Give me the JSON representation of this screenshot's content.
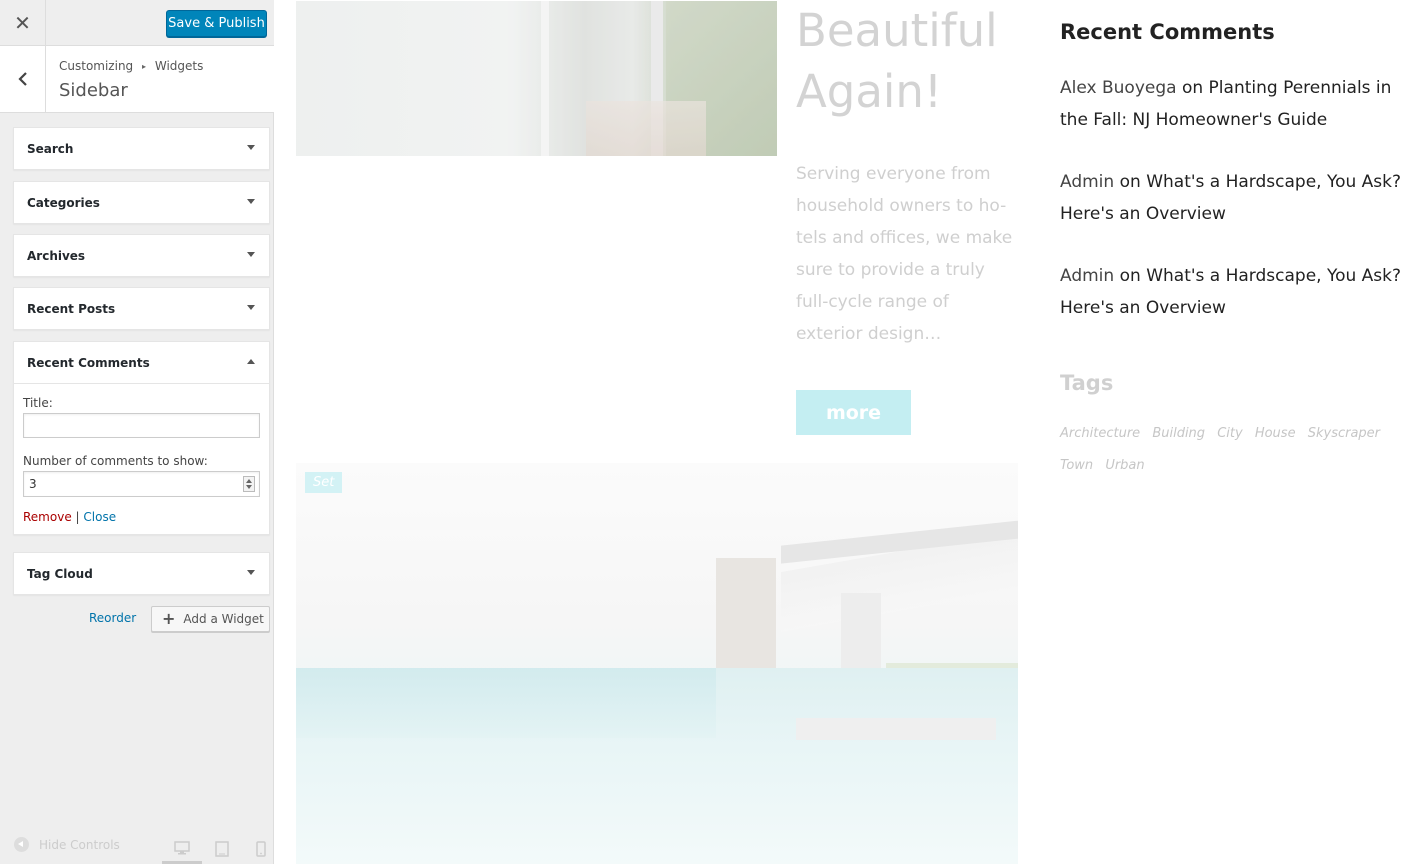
{
  "customizer": {
    "close_label": "✕",
    "publish_label": "Save & Publish",
    "breadcrumb": {
      "root": "Customizing",
      "separator": "▸",
      "current": "Widgets"
    },
    "section_title": "Sidebar",
    "widgets": [
      {
        "title": "Search",
        "expanded": false
      },
      {
        "title": "Categories",
        "expanded": false
      },
      {
        "title": "Archives",
        "expanded": false
      },
      {
        "title": "Recent Posts",
        "expanded": false
      },
      {
        "title": "Recent Comments",
        "expanded": true
      },
      {
        "title": "Tag Cloud",
        "expanded": false
      }
    ],
    "recent_comments_form": {
      "title_label": "Title:",
      "title_value": "",
      "number_label": "Number of comments to show:",
      "number_value": "3",
      "remove_label": "Remove",
      "divider": "|",
      "close_label": "Close"
    },
    "reorder_label": "Reorder",
    "add_widget_label": "Add a Widget",
    "hide_controls_label": "Hide Controls",
    "devices": [
      "desktop-icon",
      "tablet-icon",
      "mobile-icon"
    ]
  },
  "preview": {
    "post_title_lines": [
      "Beautiful",
      "Again!"
    ],
    "post_excerpt": "Serving everyone from household owners to ho-tels and offices, we make sure to provide a truly full-cycle range of exterior design…",
    "more_label": "more",
    "set_badge": "Set",
    "sidebar": {
      "recent_comments_heading": "Recent Comments",
      "comments": [
        {
          "author": "Alex Buoyega",
          "on": "on",
          "post": "Planting Perennials in the Fall: NJ Homeowner's Guide"
        },
        {
          "author": "Admin",
          "on": "on",
          "post": "What's a Hardscape, You Ask? Here's an Overview"
        },
        {
          "author": "Admin",
          "on": "on",
          "post": "What's a Hardscape, You Ask? Here's an Overview"
        }
      ],
      "tags_heading": "Tags",
      "tags": [
        "Architecture",
        "Building",
        "City",
        "House",
        "Skyscraper",
        "Town",
        "Urban"
      ]
    }
  },
  "colors": {
    "publish_button": "#0085ba",
    "remove_link": "#aa0000",
    "link_blue": "#0073aa",
    "more_button": "#c4eef2"
  }
}
